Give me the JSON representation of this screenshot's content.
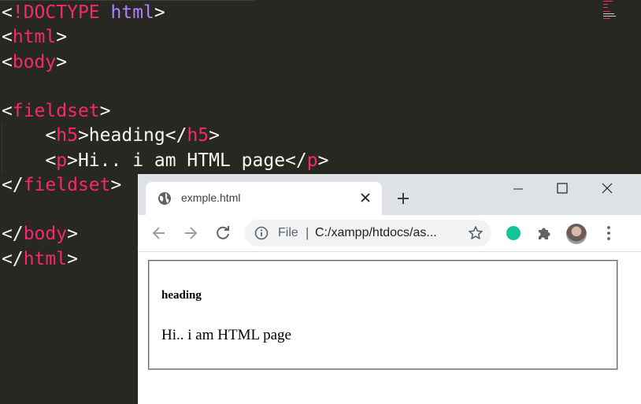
{
  "editor": {
    "lines": [
      [
        {
          "t": "<",
          "c": "plain"
        },
        {
          "t": "!DOCTYPE",
          "c": "kw"
        },
        {
          "t": " ",
          "c": "plain"
        },
        {
          "t": "html",
          "c": "attr"
        },
        {
          "t": ">",
          "c": "plain"
        }
      ],
      [
        {
          "t": "<",
          "c": "plain"
        },
        {
          "t": "html",
          "c": "kw"
        },
        {
          "t": ">",
          "c": "plain"
        }
      ],
      [
        {
          "t": "<",
          "c": "plain"
        },
        {
          "t": "body",
          "c": "kw"
        },
        {
          "t": ">",
          "c": "plain"
        }
      ],
      [],
      [
        {
          "t": "<",
          "c": "plain"
        },
        {
          "t": "fieldset",
          "c": "kw"
        },
        {
          "t": ">",
          "c": "plain"
        }
      ],
      [
        {
          "t": "    <",
          "c": "plain"
        },
        {
          "t": "h5",
          "c": "kw"
        },
        {
          "t": ">heading</",
          "c": "plain"
        },
        {
          "t": "h5",
          "c": "kw"
        },
        {
          "t": ">",
          "c": "plain"
        }
      ],
      [
        {
          "t": "    <",
          "c": "plain"
        },
        {
          "t": "p",
          "c": "kw"
        },
        {
          "t": ">Hi.. i am HTML page</",
          "c": "plain"
        },
        {
          "t": "p",
          "c": "kw"
        },
        {
          "t": ">",
          "c": "plain"
        }
      ],
      [
        {
          "t": "</",
          "c": "plain"
        },
        {
          "t": "fieldset",
          "c": "kw"
        },
        {
          "t": ">",
          "c": "plain"
        }
      ],
      [],
      [
        {
          "t": "</",
          "c": "plain"
        },
        {
          "t": "body",
          "c": "kw"
        },
        {
          "t": ">",
          "c": "plain"
        }
      ],
      [
        {
          "t": "</",
          "c": "plain"
        },
        {
          "t": "html",
          "c": "kw"
        },
        {
          "t": ">",
          "c": "plain"
        }
      ]
    ]
  },
  "browser": {
    "tab_title": "exmple.html",
    "omnibox": {
      "scheme": "File",
      "separator": "|",
      "url": "C:/xampp/htdocs/as..."
    },
    "page": {
      "heading": "heading",
      "paragraph": "Hi.. i am HTML page"
    }
  },
  "colors": {
    "editor_bg": "#272822",
    "keyword": "#f92672",
    "attribute": "#ae81ff",
    "text": "#f8f8f2",
    "chrome_tabstrip": "#dee1e6",
    "grammarly_green": "#15c39a"
  },
  "icons": {
    "tab": "globe-icon",
    "close": "close-icon",
    "new_tab": "plus-icon",
    "back": "back-arrow-icon",
    "forward": "forward-arrow-icon",
    "reload": "reload-icon",
    "info": "info-icon",
    "star": "star-icon",
    "extension": "grammarly-icon",
    "extensions": "puzzle-icon",
    "menu": "more-vert-icon"
  }
}
